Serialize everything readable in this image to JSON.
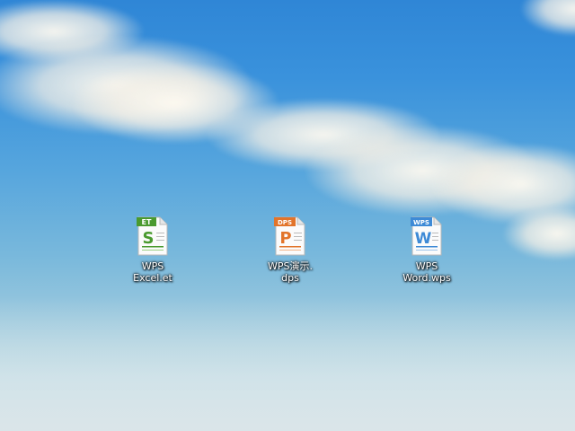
{
  "desktop": {
    "icons": [
      {
        "label": "WPS\nExcel.et",
        "badge": "ET",
        "letter": "S",
        "accent": "#4a9a2f",
        "icon": "wps-spreadsheet-file-icon"
      },
      {
        "label": "WPS演示.\ndps",
        "badge": "DPS",
        "letter": "P",
        "accent": "#e2742a",
        "icon": "wps-presentation-file-icon"
      },
      {
        "label": "WPS\nWord.wps",
        "badge": "WPS",
        "letter": "W",
        "accent": "#3e8ad6",
        "icon": "wps-writer-file-icon"
      }
    ]
  }
}
